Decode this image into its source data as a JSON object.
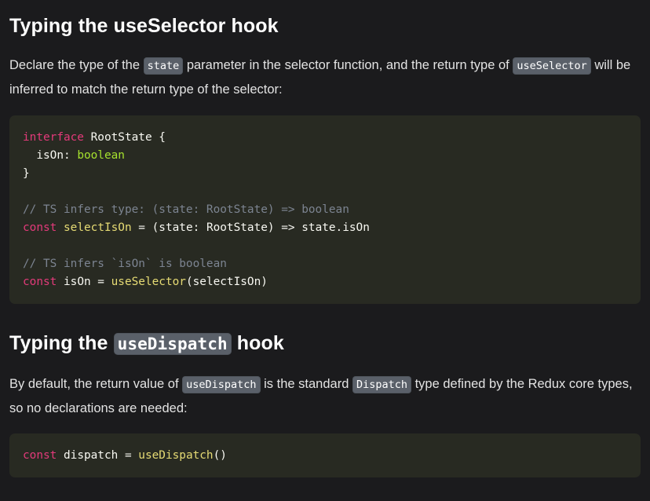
{
  "section1": {
    "heading": "Typing the useSelector hook",
    "paragraph": {
      "before": "Declare the type of the ",
      "code1": "state",
      "middle": " parameter in the selector function, and the return type of ",
      "code2": "useSelector",
      "after": " will be inferred to match the return type of the selector:"
    },
    "code_lines": [
      [
        {
          "cls": "kw",
          "t": "interface"
        },
        {
          "cls": "txt",
          "t": " RootState {"
        }
      ],
      [
        {
          "cls": "txt",
          "t": "  isOn: "
        },
        {
          "cls": "type",
          "t": "boolean"
        }
      ],
      [
        {
          "cls": "txt",
          "t": "}"
        }
      ],
      [],
      [
        {
          "cls": "cmt",
          "t": "// TS infers type: (state: RootState) => boolean"
        }
      ],
      [
        {
          "cls": "kw",
          "t": "const"
        },
        {
          "cls": "txt",
          "t": " "
        },
        {
          "cls": "fn",
          "t": "selectIsOn"
        },
        {
          "cls": "txt",
          "t": " = (state: RootState) => state.isOn"
        }
      ],
      [],
      [
        {
          "cls": "cmt",
          "t": "// TS infers `isOn` is boolean"
        }
      ],
      [
        {
          "cls": "kw",
          "t": "const"
        },
        {
          "cls": "txt",
          "t": " isOn = "
        },
        {
          "cls": "fn",
          "t": "useSelector"
        },
        {
          "cls": "txt",
          "t": "(selectIsOn)"
        }
      ]
    ]
  },
  "section2": {
    "heading_before": "Typing the ",
    "heading_code": "useDispatch",
    "heading_after": " hook",
    "paragraph": {
      "before": "By default, the return value of ",
      "code1": "useDispatch",
      "middle": " is the standard ",
      "code2": "Dispatch",
      "after": " type defined by the Redux core types, so no declarations are needed:"
    },
    "code_lines": [
      [
        {
          "cls": "kw",
          "t": "const"
        },
        {
          "cls": "txt",
          "t": " dispatch = "
        },
        {
          "cls": "fn",
          "t": "useDispatch"
        },
        {
          "cls": "txt",
          "t": "()"
        }
      ]
    ]
  },
  "colors": {
    "background": "#1b1b1d",
    "code_background": "#282a22",
    "inline_code_background": "#5a6069",
    "keyword": "#e33a7a",
    "type": "#a6e22e",
    "function": "#e6db74",
    "comment": "#7c8491"
  }
}
